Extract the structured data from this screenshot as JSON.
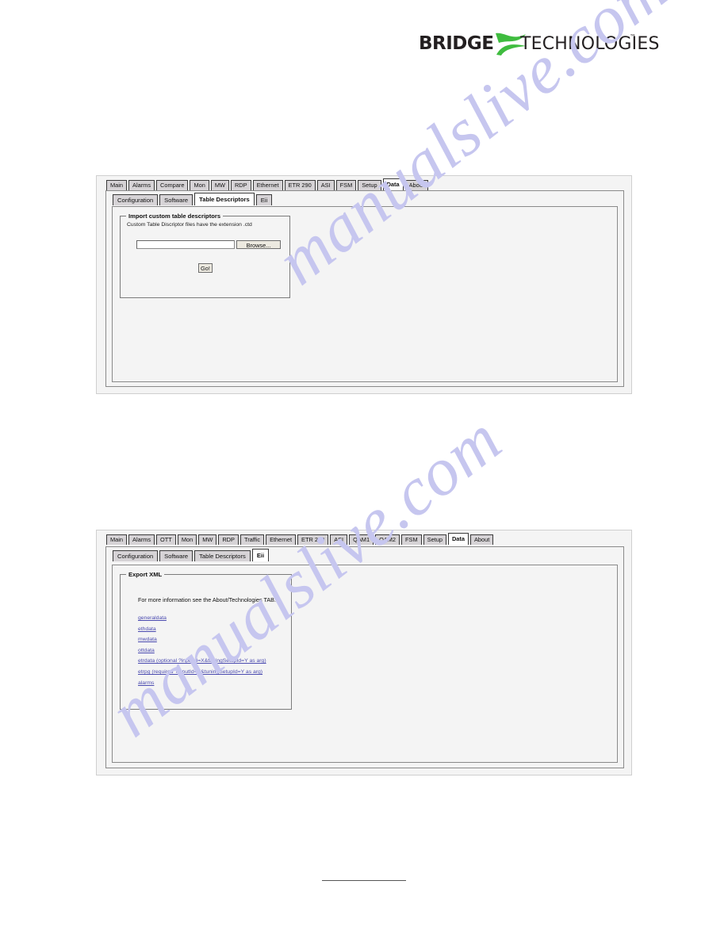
{
  "logo": {
    "brand": "BRIDGE",
    "word": "TECHNOLOGIES",
    "trademark": "™",
    "swoosh_color": "#3fbc3f",
    "text_color": "#231f20"
  },
  "watermark": {
    "line_1": "manualslive.com",
    "line_2": "manualslive.com",
    "color": "#c6c6ef"
  },
  "screenshot_1": {
    "tabs": [
      {
        "label": "Main",
        "active": false
      },
      {
        "label": "Alarms",
        "active": false
      },
      {
        "label": "Compare",
        "active": false
      },
      {
        "label": "Mon",
        "active": false
      },
      {
        "label": "MW",
        "active": false
      },
      {
        "label": "RDP",
        "active": false
      },
      {
        "label": "Ethernet",
        "active": false
      },
      {
        "label": "ETR 290",
        "active": false
      },
      {
        "label": "ASI",
        "active": false
      },
      {
        "label": "FSM",
        "active": false
      },
      {
        "label": "Setup",
        "active": false
      },
      {
        "label": "Data",
        "active": true
      },
      {
        "label": "About",
        "active": false
      }
    ],
    "subtabs": [
      {
        "label": "Configuration",
        "active": false
      },
      {
        "label": "Software",
        "active": false
      },
      {
        "label": "Table Descriptors",
        "active": true
      },
      {
        "label": "Eii",
        "active": false
      }
    ],
    "group": {
      "legend": "Import custom table descriptors",
      "note": "Custom Table Discriptor files have the extension .ctd",
      "file_input_value": "",
      "file_input_placeholder": "",
      "browse_label": "Browse...",
      "go_label": "Go!"
    }
  },
  "screenshot_2": {
    "tabs": [
      {
        "label": "Main",
        "active": false
      },
      {
        "label": "Alarms",
        "active": false
      },
      {
        "label": "OTT",
        "active": false
      },
      {
        "label": "Mon",
        "active": false
      },
      {
        "label": "MW",
        "active": false
      },
      {
        "label": "RDP",
        "active": false
      },
      {
        "label": "Traffic",
        "active": false
      },
      {
        "label": "Ethernet",
        "active": false
      },
      {
        "label": "ETR 290",
        "active": false
      },
      {
        "label": "ASI",
        "active": false
      },
      {
        "label": "QAM1",
        "active": false
      },
      {
        "label": "QAM2",
        "active": false
      },
      {
        "label": "FSM",
        "active": false
      },
      {
        "label": "Setup",
        "active": false
      },
      {
        "label": "Data",
        "active": true
      },
      {
        "label": "About",
        "active": false
      }
    ],
    "subtabs": [
      {
        "label": "Configuration",
        "active": false
      },
      {
        "label": "Software",
        "active": false
      },
      {
        "label": "Table Descriptors",
        "active": false
      },
      {
        "label": "Eii",
        "active": true
      }
    ],
    "group": {
      "legend": "Export XML",
      "info": "For more information see the About/Technologies TAB.",
      "links": [
        "generaldata",
        "ethdata",
        "mwdata",
        "ottdata",
        "etrdata (optional ?inputId=X&tuningSetupId=Y as arg)",
        "etrpg (required ?inputId=X&tuningSetupId=Y as arg)",
        "alarms"
      ],
      "link_color": "#4b4bb0"
    }
  }
}
